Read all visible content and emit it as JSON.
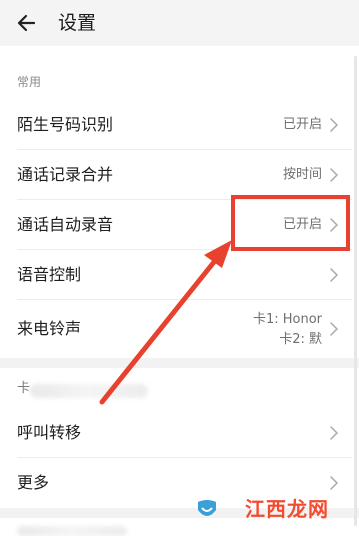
{
  "header": {
    "title": "设置"
  },
  "section": {
    "common_label": "常用"
  },
  "rows": [
    {
      "label": "陌生号码识别",
      "value": "已开启"
    },
    {
      "label": "通话记录合并",
      "value": "按时间"
    },
    {
      "label": "通话自动录音",
      "value": "已开启"
    },
    {
      "label": "语音控制",
      "value": ""
    },
    {
      "label": "来电铃声",
      "value_line1": "卡1: Honor",
      "value_line2": "卡2: 默"
    },
    {
      "label": "呼叫转移",
      "value": ""
    },
    {
      "label": "更多",
      "value": ""
    }
  ],
  "blurred_section_prefix": "卡",
  "watermark": {
    "text": "江西龙网"
  },
  "colors": {
    "highlight": "#e8412f",
    "background": "#ffffff",
    "section_gap": "#f2f2f2",
    "text_primary": "#1f1f1f",
    "text_secondary": "#6f6f6f"
  }
}
